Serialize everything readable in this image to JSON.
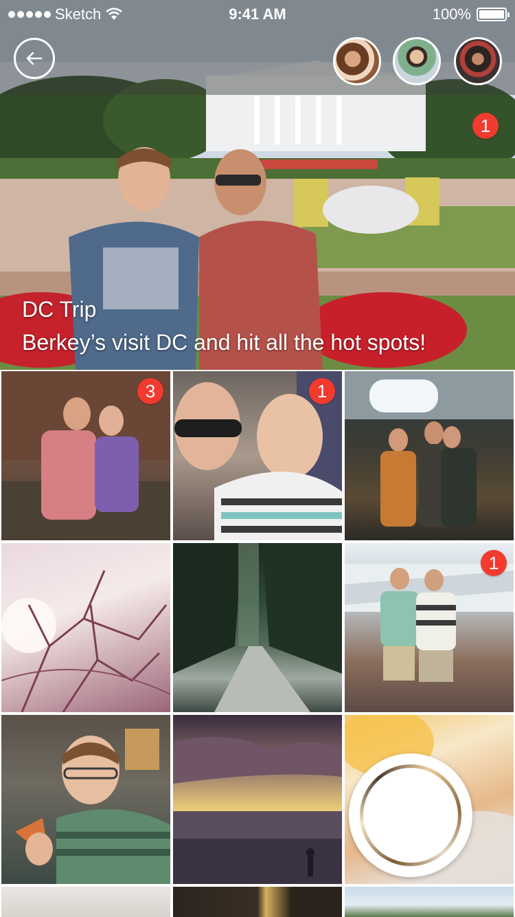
{
  "status_bar": {
    "carrier": "Sketch",
    "time": "9:41 AM",
    "battery": "100%"
  },
  "header": {
    "back_icon": "back-arrow-icon",
    "avatars": [
      {
        "name": "avatar-couple"
      },
      {
        "name": "avatar-teen"
      },
      {
        "name": "avatar-group"
      }
    ]
  },
  "hero": {
    "title": "DC Trip",
    "subtitle": "Berkey’s visit DC and hit all the hot spots!",
    "badge": "1"
  },
  "grid": {
    "tiles": [
      {
        "badge": "3"
      },
      {
        "badge": "1"
      },
      {
        "badge": ""
      },
      {
        "badge": ""
      },
      {
        "badge": ""
      },
      {
        "badge": "1"
      },
      {
        "badge": ""
      },
      {
        "badge": ""
      }
    ]
  },
  "colors": {
    "badge": "#f23a2f",
    "overlay": "#3c3c3c"
  }
}
